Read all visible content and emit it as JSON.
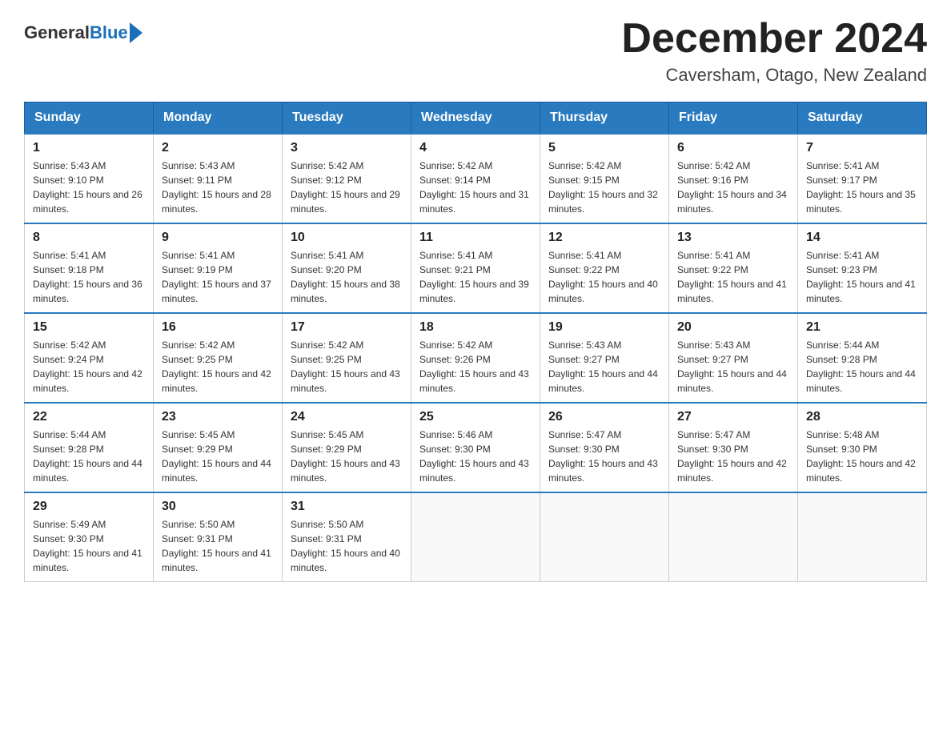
{
  "header": {
    "logo_text_general": "General",
    "logo_text_blue": "Blue",
    "title": "December 2024",
    "subtitle": "Caversham, Otago, New Zealand"
  },
  "days_of_week": [
    "Sunday",
    "Monday",
    "Tuesday",
    "Wednesday",
    "Thursday",
    "Friday",
    "Saturday"
  ],
  "weeks": [
    [
      {
        "num": "1",
        "sunrise": "5:43 AM",
        "sunset": "9:10 PM",
        "daylight": "15 hours and 26 minutes."
      },
      {
        "num": "2",
        "sunrise": "5:43 AM",
        "sunset": "9:11 PM",
        "daylight": "15 hours and 28 minutes."
      },
      {
        "num": "3",
        "sunrise": "5:42 AM",
        "sunset": "9:12 PM",
        "daylight": "15 hours and 29 minutes."
      },
      {
        "num": "4",
        "sunrise": "5:42 AM",
        "sunset": "9:14 PM",
        "daylight": "15 hours and 31 minutes."
      },
      {
        "num": "5",
        "sunrise": "5:42 AM",
        "sunset": "9:15 PM",
        "daylight": "15 hours and 32 minutes."
      },
      {
        "num": "6",
        "sunrise": "5:42 AM",
        "sunset": "9:16 PM",
        "daylight": "15 hours and 34 minutes."
      },
      {
        "num": "7",
        "sunrise": "5:41 AM",
        "sunset": "9:17 PM",
        "daylight": "15 hours and 35 minutes."
      }
    ],
    [
      {
        "num": "8",
        "sunrise": "5:41 AM",
        "sunset": "9:18 PM",
        "daylight": "15 hours and 36 minutes."
      },
      {
        "num": "9",
        "sunrise": "5:41 AM",
        "sunset": "9:19 PM",
        "daylight": "15 hours and 37 minutes."
      },
      {
        "num": "10",
        "sunrise": "5:41 AM",
        "sunset": "9:20 PM",
        "daylight": "15 hours and 38 minutes."
      },
      {
        "num": "11",
        "sunrise": "5:41 AM",
        "sunset": "9:21 PM",
        "daylight": "15 hours and 39 minutes."
      },
      {
        "num": "12",
        "sunrise": "5:41 AM",
        "sunset": "9:22 PM",
        "daylight": "15 hours and 40 minutes."
      },
      {
        "num": "13",
        "sunrise": "5:41 AM",
        "sunset": "9:22 PM",
        "daylight": "15 hours and 41 minutes."
      },
      {
        "num": "14",
        "sunrise": "5:41 AM",
        "sunset": "9:23 PM",
        "daylight": "15 hours and 41 minutes."
      }
    ],
    [
      {
        "num": "15",
        "sunrise": "5:42 AM",
        "sunset": "9:24 PM",
        "daylight": "15 hours and 42 minutes."
      },
      {
        "num": "16",
        "sunrise": "5:42 AM",
        "sunset": "9:25 PM",
        "daylight": "15 hours and 42 minutes."
      },
      {
        "num": "17",
        "sunrise": "5:42 AM",
        "sunset": "9:25 PM",
        "daylight": "15 hours and 43 minutes."
      },
      {
        "num": "18",
        "sunrise": "5:42 AM",
        "sunset": "9:26 PM",
        "daylight": "15 hours and 43 minutes."
      },
      {
        "num": "19",
        "sunrise": "5:43 AM",
        "sunset": "9:27 PM",
        "daylight": "15 hours and 44 minutes."
      },
      {
        "num": "20",
        "sunrise": "5:43 AM",
        "sunset": "9:27 PM",
        "daylight": "15 hours and 44 minutes."
      },
      {
        "num": "21",
        "sunrise": "5:44 AM",
        "sunset": "9:28 PM",
        "daylight": "15 hours and 44 minutes."
      }
    ],
    [
      {
        "num": "22",
        "sunrise": "5:44 AM",
        "sunset": "9:28 PM",
        "daylight": "15 hours and 44 minutes."
      },
      {
        "num": "23",
        "sunrise": "5:45 AM",
        "sunset": "9:29 PM",
        "daylight": "15 hours and 44 minutes."
      },
      {
        "num": "24",
        "sunrise": "5:45 AM",
        "sunset": "9:29 PM",
        "daylight": "15 hours and 43 minutes."
      },
      {
        "num": "25",
        "sunrise": "5:46 AM",
        "sunset": "9:30 PM",
        "daylight": "15 hours and 43 minutes."
      },
      {
        "num": "26",
        "sunrise": "5:47 AM",
        "sunset": "9:30 PM",
        "daylight": "15 hours and 43 minutes."
      },
      {
        "num": "27",
        "sunrise": "5:47 AM",
        "sunset": "9:30 PM",
        "daylight": "15 hours and 42 minutes."
      },
      {
        "num": "28",
        "sunrise": "5:48 AM",
        "sunset": "9:30 PM",
        "daylight": "15 hours and 42 minutes."
      }
    ],
    [
      {
        "num": "29",
        "sunrise": "5:49 AM",
        "sunset": "9:30 PM",
        "daylight": "15 hours and 41 minutes."
      },
      {
        "num": "30",
        "sunrise": "5:50 AM",
        "sunset": "9:31 PM",
        "daylight": "15 hours and 41 minutes."
      },
      {
        "num": "31",
        "sunrise": "5:50 AM",
        "sunset": "9:31 PM",
        "daylight": "15 hours and 40 minutes."
      },
      null,
      null,
      null,
      null
    ]
  ]
}
